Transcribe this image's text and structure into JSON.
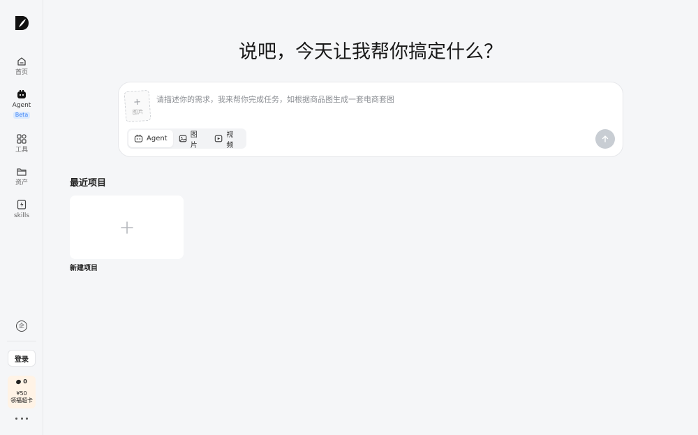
{
  "sidebar": {
    "items": [
      {
        "label": "首页",
        "icon": "home-icon"
      },
      {
        "label": "Agent",
        "icon": "agent-icon",
        "badge": "Beta"
      },
      {
        "label": "工具",
        "icon": "tools-grid-icon"
      },
      {
        "label": "资产",
        "icon": "folder-icon"
      },
      {
        "label": "skills",
        "icon": "skills-icon"
      }
    ],
    "enterprise_glyph": "企",
    "login_label": "登录",
    "promo": {
      "coins": "0",
      "price": "¥50",
      "text": "领福超卡"
    }
  },
  "headline": "说吧，今天让我帮你搞定什么？",
  "composer": {
    "upload_plus": "+",
    "upload_label": "图片",
    "placeholder": "请描述你的需求，我来帮你完成任务，如根据商品图生成一套电商套图",
    "modes": [
      {
        "label": "Agent",
        "icon": "agent-mode-icon"
      },
      {
        "label": "图片",
        "icon": "image-mode-icon"
      },
      {
        "label": "视频",
        "icon": "video-mode-icon"
      }
    ],
    "active_mode": "Agent"
  },
  "recent": {
    "title": "最近项目",
    "new_project_label": "新建项目"
  },
  "colors": {
    "background": "#f5f6f8",
    "card": "#ffffff",
    "send_disabled": "#c8cdd3",
    "beta_badge_bg": "#dbeafe",
    "beta_badge_text": "#3b82f6",
    "promo_bg": "#fff3e6"
  }
}
